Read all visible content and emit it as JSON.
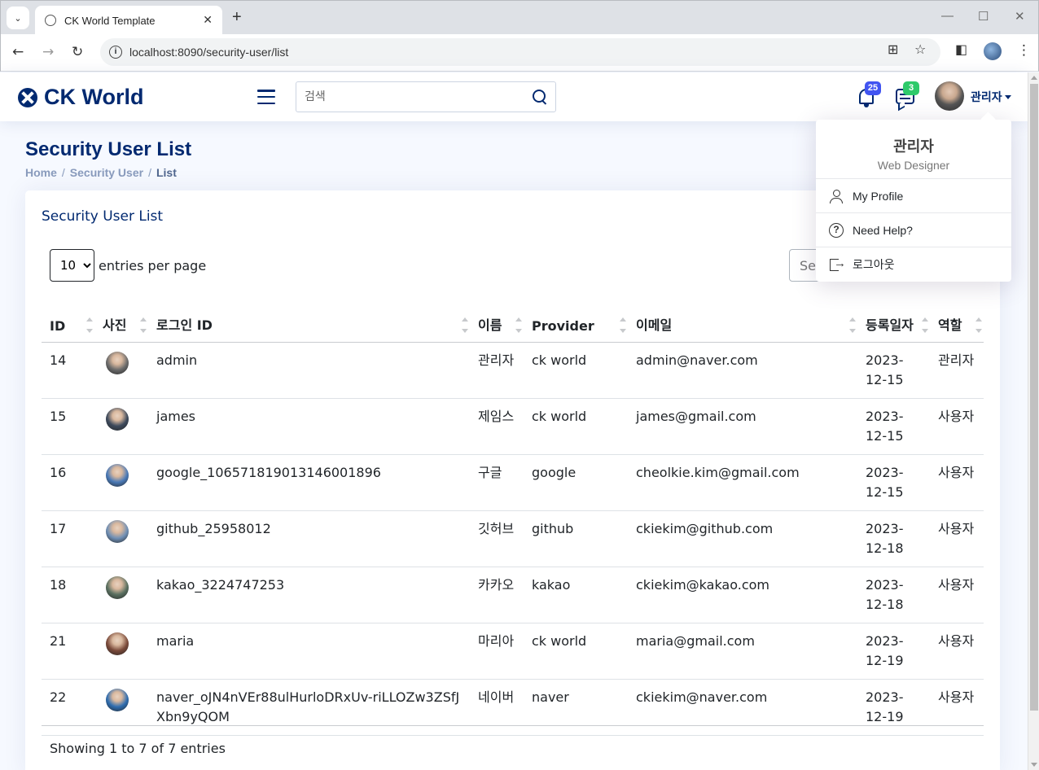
{
  "browser": {
    "tab_title": "CK World Template",
    "url": "localhost:8090/security-user/list",
    "new_tab": "+",
    "tab_close": "✕"
  },
  "header": {
    "logo_text": "CK World",
    "search_placeholder": "검색",
    "notifications_count": "25",
    "messages_count": "3",
    "profile_name": "관리자"
  },
  "page": {
    "title": "Security User List",
    "breadcrumb": [
      "Home",
      "Security User",
      "List"
    ]
  },
  "card": {
    "title": "Security User List",
    "per_page_value": "10",
    "per_page_label": "entries per page",
    "search_placeholder": "Search...",
    "info": "Showing 1 to 7 of 7 entries"
  },
  "table": {
    "columns": [
      "ID",
      "사진",
      "로그인 ID",
      "이름",
      "Provider",
      "이메일",
      "등록일자",
      "역할"
    ],
    "rows": [
      {
        "id": "14",
        "login": "admin",
        "name": "관리자",
        "provider": "ck world",
        "email": "admin@naver.com",
        "date": "2023-12-15",
        "role": "관리자",
        "photo_color": "#6b6b6b"
      },
      {
        "id": "15",
        "login": "james",
        "name": "제임스",
        "provider": "ck world",
        "email": "james@gmail.com",
        "date": "2023-12-15",
        "role": "사용자",
        "photo_color": "#3d4a5c"
      },
      {
        "id": "16",
        "login": "google_106571819013146001896",
        "name": "구글",
        "provider": "google",
        "email": "cheolkie.kim@gmail.com",
        "date": "2023-12-15",
        "role": "사용자",
        "photo_color": "#4a7ab8"
      },
      {
        "id": "17",
        "login": "github_25958012",
        "name": "깃허브",
        "provider": "github",
        "email": "ckiekim@github.com",
        "date": "2023-12-18",
        "role": "사용자",
        "photo_color": "#6f8fb5"
      },
      {
        "id": "18",
        "login": "kakao_3224747253",
        "name": "카카오",
        "provider": "kakao",
        "email": "ckiekim@kakao.com",
        "date": "2023-12-18",
        "role": "사용자",
        "photo_color": "#5a7060"
      },
      {
        "id": "21",
        "login": "maria",
        "name": "마리아",
        "provider": "ck world",
        "email": "maria@gmail.com",
        "date": "2023-12-19",
        "role": "사용자",
        "photo_color": "#7a4a3a"
      },
      {
        "id": "22",
        "login": "naver_oJN4nVEr88ulHurloDRxUv-riLLOZw3ZSfJXbn9yQOM",
        "name": "네이버",
        "provider": "naver",
        "email": "ckiekim@naver.com",
        "date": "2023-12-19",
        "role": "사용자",
        "photo_color": "#2f6db0"
      }
    ]
  },
  "dropdown": {
    "name": "관리자",
    "role": "Web Designer",
    "items": [
      "My Profile",
      "Need Help?",
      "로그아웃"
    ]
  }
}
